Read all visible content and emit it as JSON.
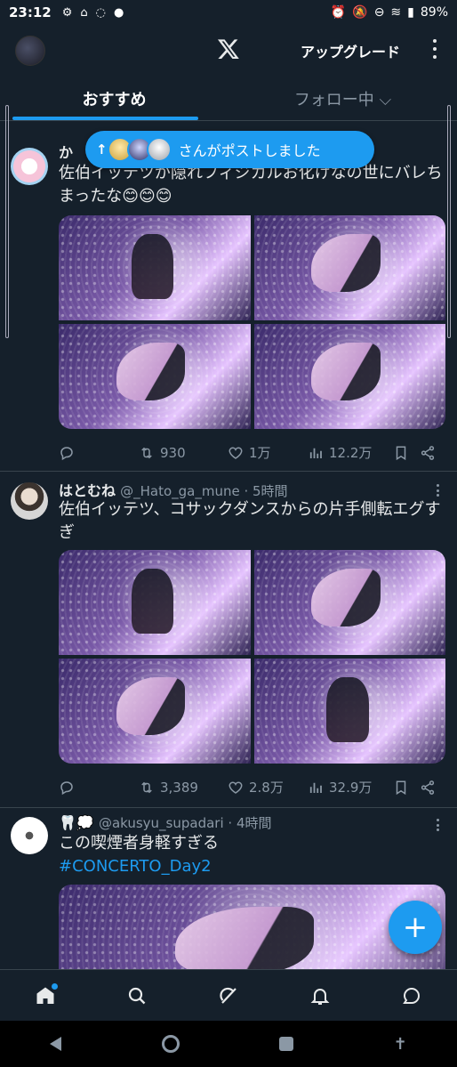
{
  "status": {
    "time": "23:12",
    "battery": "89%"
  },
  "header": {
    "upgrade": "アップグレード"
  },
  "tabs": [
    {
      "label": "おすすめ"
    },
    {
      "label": "フォロー中 ⌵"
    }
  ],
  "toast": {
    "text": "さんがポストしました",
    "arrow": "↑"
  },
  "tweets": [
    {
      "name": "か",
      "text": "佐伯イッテツが隠れフィジカルお化けなの世にバレちまったな😊😊😊",
      "replies": "",
      "retweets": "930",
      "likes": "1万",
      "views": "12.2万"
    },
    {
      "name": "はとむね",
      "meta": "@_Hato_ga_mune · 5時間",
      "text": "佐伯イッテツ、コサックダンスからの片手側転エグすぎ",
      "replies": "",
      "retweets": "3,389",
      "likes": "2.8万",
      "views": "32.9万"
    },
    {
      "name": "🦷💭",
      "meta": "@akusyu_supadari · 4時間",
      "text": "この喫煙者身軽すぎる",
      "hashtag": "#CONCERTO_Day2"
    }
  ],
  "colors": {
    "accent": "#1d9bf0",
    "background": "#15202b",
    "muted": "#8b98a5"
  }
}
